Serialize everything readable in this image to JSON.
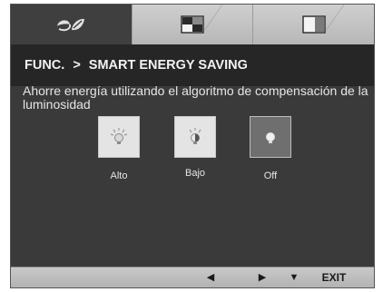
{
  "breadcrumb": {
    "menu": "FUNC.",
    "separator": ">",
    "page": "SMART ENERGY SAVING"
  },
  "description": "Ahorre energía utilizando el algoritmo de compensación de la luminosidad",
  "options": [
    {
      "label": "Alto",
      "icon": "bulb-icon",
      "selected": false
    },
    {
      "label": "Bajo",
      "icon": "bulb-icon",
      "selected": false
    },
    {
      "label": "Off",
      "icon": "bulb-icon",
      "selected": true
    }
  ],
  "bottom_bar": {
    "left_icon": "triangle-left-icon",
    "right_icon": "triangle-right-icon",
    "down_icon": "triangle-down-icon",
    "exit_label": "EXIT"
  },
  "tabs": [
    {
      "icon": "eco-leaf-icon",
      "active": true
    },
    {
      "icon": "picture-icon",
      "active": false
    },
    {
      "icon": "color-icon",
      "active": false
    }
  ],
  "colors": {
    "panel": "#3a3a3a",
    "header": "#262626",
    "tab_bar": "#c4c4c4",
    "bottom_bar": "#bdbdbd",
    "text": "#e6e6e6"
  }
}
